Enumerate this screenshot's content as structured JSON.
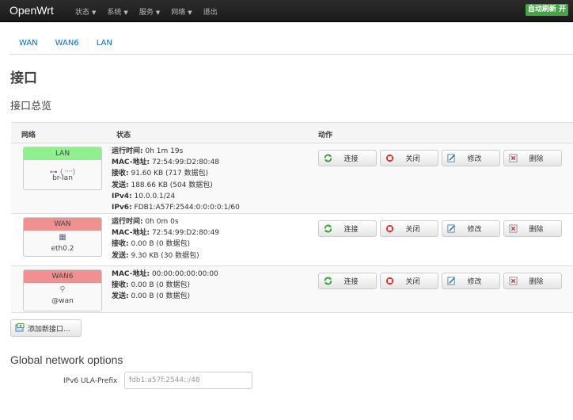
{
  "navbar": {
    "brand": "OpenWrt",
    "menu": [
      {
        "label": "状态"
      },
      {
        "label": "系统"
      },
      {
        "label": "服务"
      },
      {
        "label": "网络"
      },
      {
        "label": "退出"
      }
    ],
    "refresh_label": "自动刷新 开"
  },
  "tabs": [
    "WAN",
    "WAN6",
    "LAN"
  ],
  "page_title": "接口",
  "section_title": "接口总览",
  "table": {
    "headers": {
      "network": "网络",
      "status": "状态",
      "actions": "动作"
    },
    "rows": [
      {
        "name": "LAN",
        "state": "up",
        "device": "br-lan",
        "status": [
          {
            "key": "运行时间:",
            "value": " 0h 1m 19s"
          },
          {
            "key": "MAC-地址:",
            "value": " 72:54:99:D2:80:48"
          },
          {
            "key": "接收:",
            "value": " 91.60 KB (717 数据包)"
          },
          {
            "key": "发送:",
            "value": " 188.66 KB (504 数据包)"
          },
          {
            "key": "IPv4:",
            "value": " 10.0.0.1/24"
          },
          {
            "key": "IPv6:",
            "value": " FDB1:A57F:2544:0:0:0:0:1/60"
          }
        ]
      },
      {
        "name": "WAN",
        "state": "down",
        "device": "eth0.2",
        "status": [
          {
            "key": "运行时间:",
            "value": " 0h 0m 0s"
          },
          {
            "key": "MAC-地址:",
            "value": " 72:54:99:D2:80:49"
          },
          {
            "key": "接收:",
            "value": " 0.00 B (0 数据包)"
          },
          {
            "key": "发送:",
            "value": " 9.30 KB (30 数据包)"
          }
        ]
      },
      {
        "name": "WAN6",
        "state": "down",
        "device": "@wan",
        "status": [
          {
            "key": "MAC-地址:",
            "value": " 00:00:00:00:00:00"
          },
          {
            "key": "接收:",
            "value": " 0.00 B (0 数据包)"
          },
          {
            "key": "发送:",
            "value": " 0.00 B (0 数据包)"
          }
        ]
      }
    ],
    "buttons": {
      "connect": "连接",
      "stop": "关闭",
      "edit": "修改",
      "delete": "删除"
    }
  },
  "add_button": "添加新接口...",
  "global": {
    "title": "Global network options",
    "ula_label": "IPv6 ULA-Prefix",
    "ula_value": "fdb1:a57f:2544::/48"
  },
  "colors": {
    "navbar": "#1f1f1f",
    "link": "#0069d6",
    "up": "#90f090",
    "down": "#f09090",
    "refresh": "#46a546"
  },
  "icons": {
    "connect": "refresh-icon",
    "stop": "stop-icon",
    "edit": "edit-icon",
    "delete": "delete-icon",
    "add": "add-interface-icon"
  }
}
